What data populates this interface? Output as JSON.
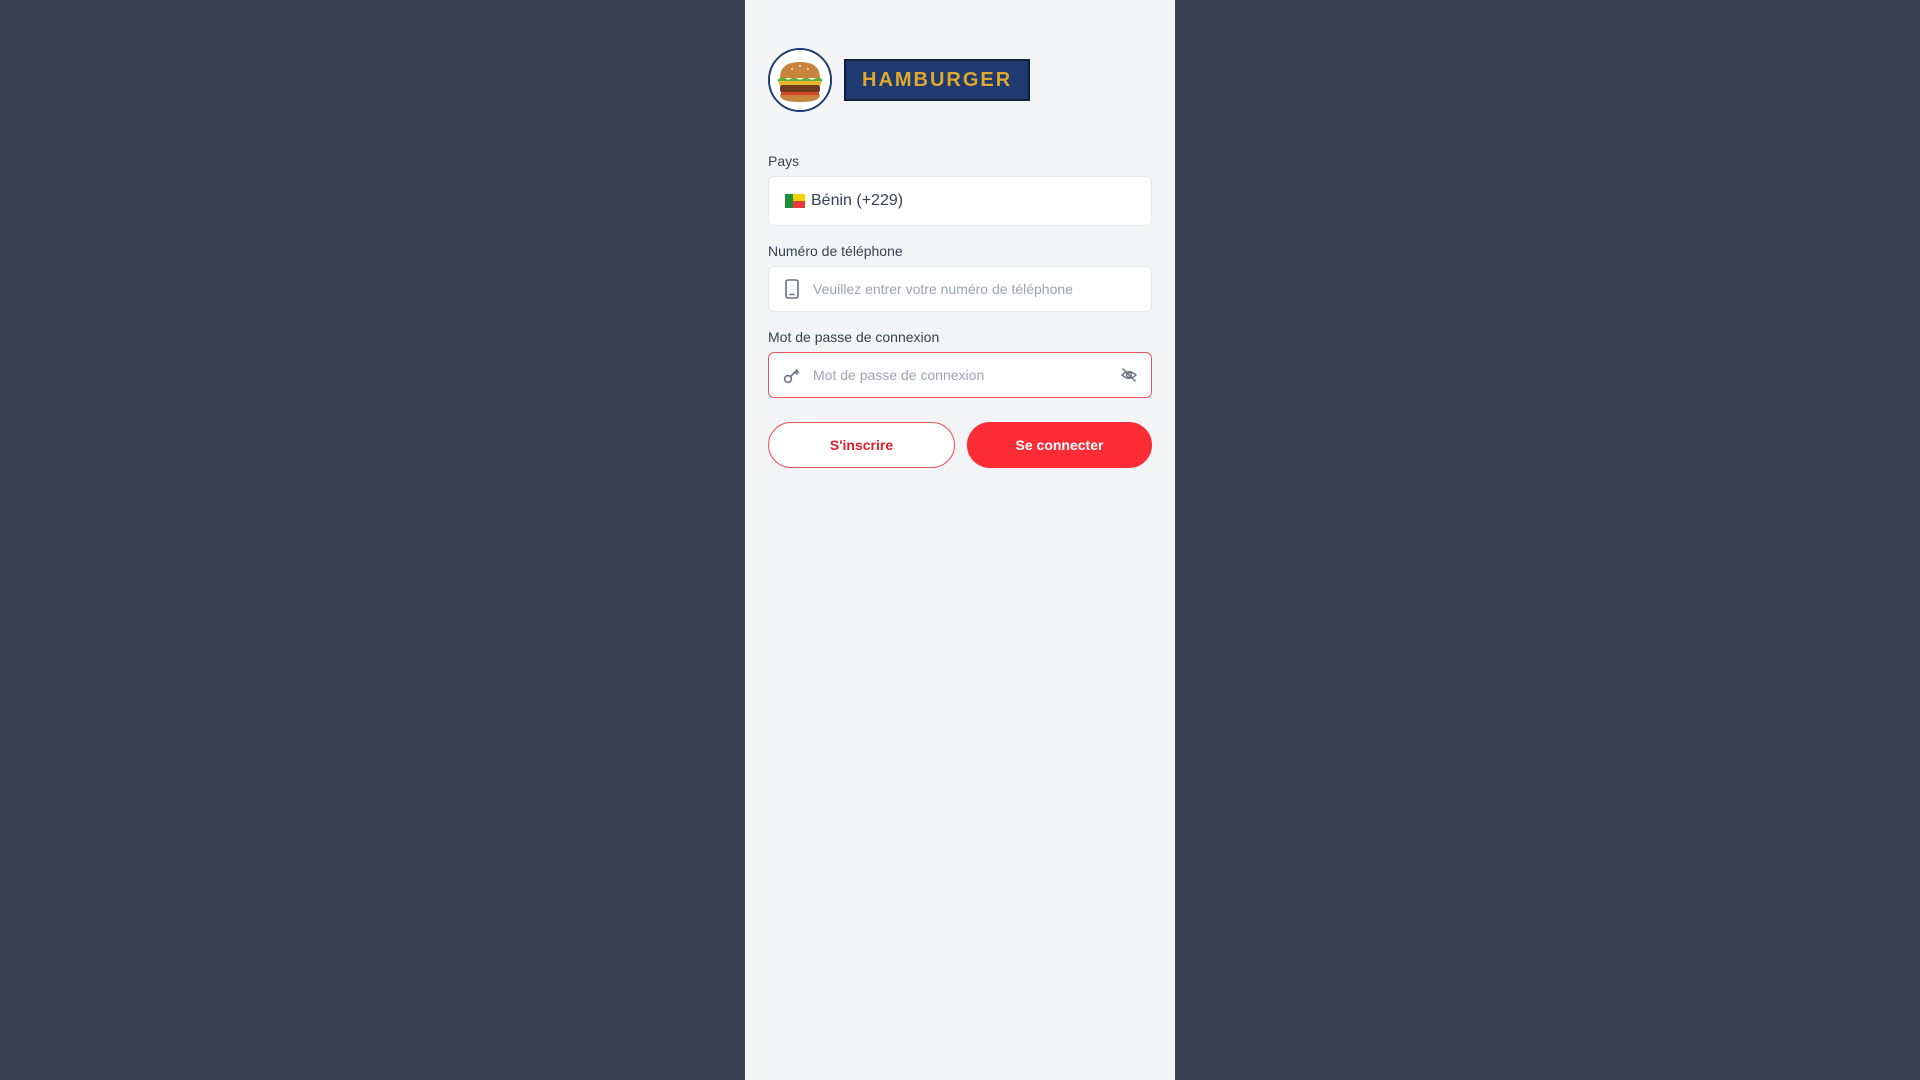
{
  "brand": {
    "name": "HAMBURGER",
    "logo_icon": "hamburger-icon"
  },
  "country": {
    "label": "Pays",
    "flag_icon": "benin-flag-icon",
    "value": "Bénin (+229)"
  },
  "phone": {
    "label": "Numéro de téléphone",
    "icon": "smartphone-icon",
    "placeholder": "Veuillez entrer votre numéro de téléphone",
    "value": ""
  },
  "password": {
    "label": "Mot de passe de connexion",
    "icon": "key-icon",
    "placeholder": "Mot de passe de connexion",
    "toggle_icon": "eye-off-icon",
    "value": ""
  },
  "actions": {
    "register_label": "S'inscrire",
    "login_label": "Se connecter"
  },
  "colors": {
    "page_background": "#374151",
    "panel_background": "#f3f4f6",
    "brand_navy": "#1e3a6e",
    "brand_gold": "#e0a82e",
    "accent_red": "#fb2c36"
  }
}
